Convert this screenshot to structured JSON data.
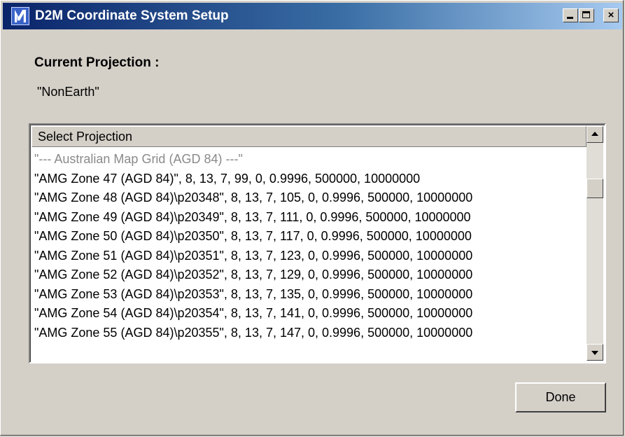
{
  "window": {
    "title": "D2M Coordinate System Setup",
    "icon": "app-logo-icon",
    "controls": {
      "minimize": "minimize-icon",
      "maximize": "maximize-icon",
      "close": "×"
    }
  },
  "current": {
    "label": "Current Projection :",
    "value": "\"NonEarth\""
  },
  "list": {
    "header": "Select Projection",
    "rows": [
      "\"--- Australian Map Grid (AGD 84) ---\"",
      "\"AMG Zone 47 (AGD 84)\", 8, 13, 7, 99, 0, 0.9996, 500000, 10000000",
      "\"AMG Zone 48 (AGD 84)\\p20348\", 8, 13, 7, 105, 0, 0.9996, 500000, 10000000",
      "\"AMG Zone 49 (AGD 84)\\p20349\", 8, 13, 7, 111, 0, 0.9996, 500000, 10000000",
      "\"AMG Zone 50 (AGD 84)\\p20350\", 8, 13, 7, 117, 0, 0.9996, 500000, 10000000",
      "\"AMG Zone 51 (AGD 84)\\p20351\", 8, 13, 7, 123, 0, 0.9996, 500000, 10000000",
      "\"AMG Zone 52 (AGD 84)\\p20352\", 8, 13, 7, 129, 0, 0.9996, 500000, 10000000",
      "\"AMG Zone 53 (AGD 84)\\p20353\", 8, 13, 7, 135, 0, 0.9996, 500000, 10000000",
      "\"AMG Zone 54 (AGD 84)\\p20354\", 8, 13, 7, 141, 0, 0.9996, 500000, 10000000",
      "\"AMG Zone 55 (AGD 84)\\p20355\", 8, 13, 7, 147, 0, 0.9996, 500000, 10000000"
    ]
  },
  "buttons": {
    "done": "Done"
  },
  "colors": {
    "titlebar_start": "#0a246a",
    "titlebar_end": "#a6caf0",
    "face": "#d4d0c8"
  }
}
